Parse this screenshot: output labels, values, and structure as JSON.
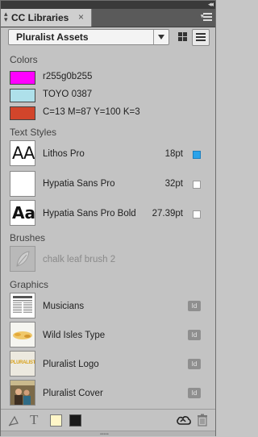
{
  "panel": {
    "tab_title": "CC Libraries",
    "tab_close": "×",
    "collapse_glyph": "◂◂",
    "library_selected": "Pluralist Assets"
  },
  "colors": {
    "header": "Colors",
    "items": [
      {
        "label": "r255g0b255",
        "swatch": "#ff00ff"
      },
      {
        "label": "TOYO 0387",
        "swatch": "#aee0ea"
      },
      {
        "label": "C=13 M=87 Y=100 K=3",
        "swatch": "#d2452b"
      }
    ]
  },
  "text_styles": {
    "header": "Text Styles",
    "items": [
      {
        "preview": "AA",
        "name": "Lithos Pro",
        "size": "18pt",
        "checked": true
      },
      {
        "preview": "",
        "name": "Hypatia Sans Pro",
        "size": "32pt",
        "checked": false
      },
      {
        "preview": "Aa",
        "name": "Hypatia Sans Pro Bold",
        "size": "27.39pt",
        "checked": false
      }
    ]
  },
  "brushes": {
    "header": "Brushes",
    "items": [
      {
        "name": "chalk leaf brush 2"
      }
    ]
  },
  "graphics": {
    "header": "Graphics",
    "items": [
      {
        "name": "Musicians",
        "badge": "Id"
      },
      {
        "name": "Wild Isles Type",
        "badge": "Id"
      },
      {
        "name": "Pluralist Logo",
        "badge": "Id",
        "thumb_text": "PLURALIST"
      },
      {
        "name": "Pluralist Cover",
        "badge": "Id"
      }
    ]
  },
  "footer": {
    "text_icon": "T",
    "accent_fill": "#fff6c8",
    "accent_stroke": "#1a1a1a"
  }
}
